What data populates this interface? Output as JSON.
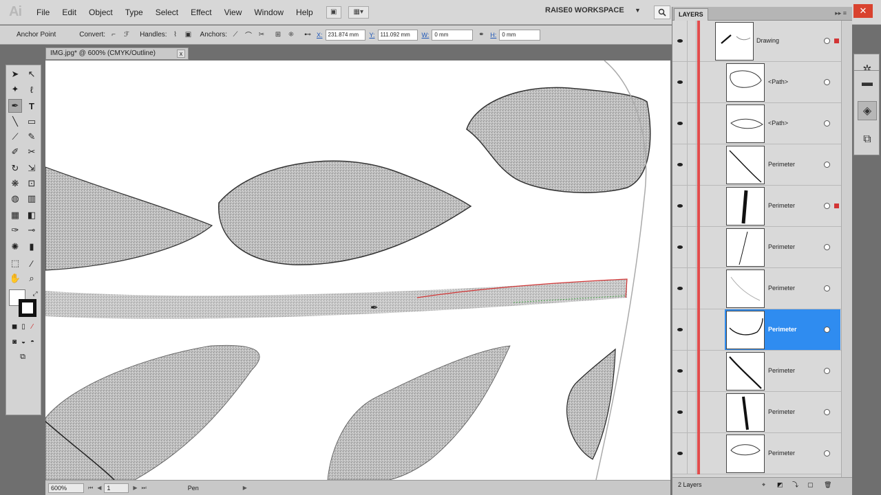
{
  "app": {
    "logo": "Ai",
    "workspace": "RAISE0 WORKSPACE"
  },
  "menu": [
    "File",
    "Edit",
    "Object",
    "Type",
    "Select",
    "Effect",
    "View",
    "Window",
    "Help"
  ],
  "control": {
    "anchor_point": "Anchor Point",
    "convert": "Convert:",
    "handles": "Handles:",
    "anchors": "Anchors:",
    "x_label": "X:",
    "x_value": "231.874 mm",
    "y_label": "Y:",
    "y_value": "111.092 mm",
    "w_label": "W:",
    "w_value": "0 mm",
    "h_label": "H:",
    "h_value": "0 mm"
  },
  "document": {
    "tab_title": "IMG.jpg* @ 600% (CMYK/Outline)",
    "close": "x"
  },
  "status": {
    "zoom": "600%",
    "page": "1",
    "current_tool": "Pen"
  },
  "layers": {
    "tab": "LAYERS",
    "footer": "2 Layers",
    "rows": [
      {
        "label": "Drawing",
        "selected": false
      },
      {
        "label": "<Path>",
        "selected": false
      },
      {
        "label": "<Path>",
        "selected": false
      },
      {
        "label": "Perimeter",
        "selected": false
      },
      {
        "label": "Perimeter",
        "selected": false
      },
      {
        "label": "Perimeter",
        "selected": false
      },
      {
        "label": "Perimeter",
        "selected": false
      },
      {
        "label": "Perimeter",
        "selected": true
      },
      {
        "label": "Perimeter",
        "selected": false
      },
      {
        "label": "Perimeter",
        "selected": false
      },
      {
        "label": "Perimeter",
        "selected": false
      }
    ]
  },
  "colors": {
    "accent": "#2f8cf0",
    "layer_color": "#e24d4d",
    "close": "#d9422e"
  }
}
